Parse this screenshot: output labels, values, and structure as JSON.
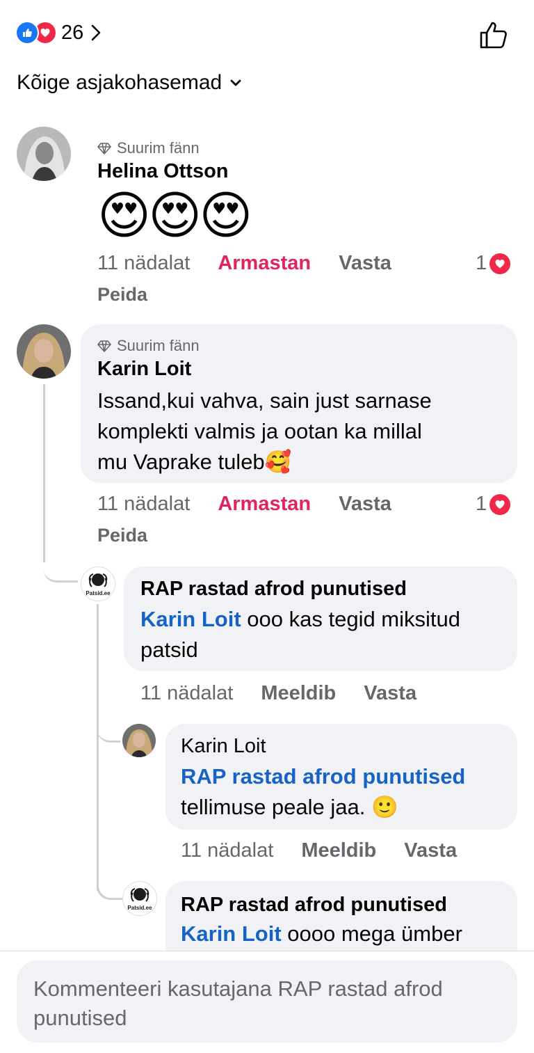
{
  "header": {
    "reaction_count": "26",
    "sort_label": "Kõige asjakohasemad"
  },
  "comments": [
    {
      "badge": "Suurim fänn",
      "author": "Helina Ottson",
      "emojis": "😍😍😍",
      "time": "11 nädalat",
      "reaction_label": "Armastan",
      "reply_label": "Vasta",
      "reaction_count": "1",
      "hide_label": "Peida"
    },
    {
      "badge": "Suurim fänn",
      "author": "Karin Loit",
      "text_line1": "Issand,kui vahva, sain just sarnase",
      "text_line2": "komplekti valmis ja ootan ka millal",
      "text_line3": "mu Vaprake tuleb🥰",
      "time": "11 nädalat",
      "reaction_label": "Armastan",
      "reply_label": "Vasta",
      "reaction_count": "1",
      "hide_label": "Peida"
    }
  ],
  "replies": [
    {
      "author": "RAP rastad afrod punutised",
      "avatar_text": "Patsid.ee",
      "mention": "Karin Loit",
      "text_rest": " ooo kas tegid miksitud",
      "text_line2": "patsid",
      "time": "11 nädalat",
      "like_label": "Meeldib",
      "reply_label": "Vasta"
    },
    {
      "author": "Karin Loit",
      "mention": "RAP rastad afrod punutised",
      "text_line2": "tellimuse peale jaa. 🙂",
      "time": "11 nädalat",
      "like_label": "Meeldib",
      "reply_label": "Vasta"
    },
    {
      "author": "RAP rastad afrod punutised",
      "avatar_text": "Patsid.ee",
      "mention": "Karin Loit",
      "text_rest": " oooo mega ümber"
    }
  ],
  "composer": {
    "placeholder": "Kommenteeri kasutajana RAP rastad afrod punutised"
  },
  "colors": {
    "love": "#e0245e",
    "mention": "#1763c5",
    "like_blue": "#1877f2",
    "bubble": "#f0f2f5",
    "meta_gray": "#65676b"
  },
  "icons": [
    "like-icon",
    "love-icon",
    "chevron-right-icon",
    "thumbs-up-icon",
    "chevron-down-icon",
    "diamond-icon",
    "heart-icon"
  ]
}
